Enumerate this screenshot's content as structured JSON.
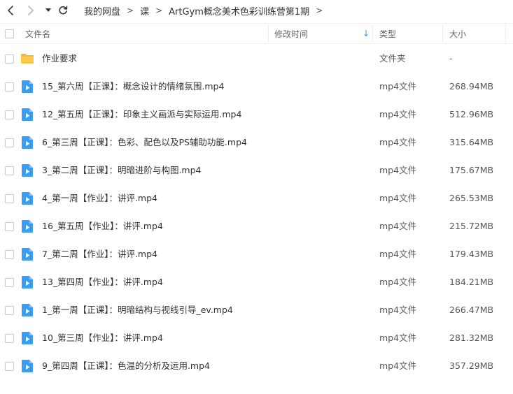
{
  "breadcrumb": {
    "items": [
      "我的网盘",
      "课",
      "ArtGym概念美术色彩训练营第1期"
    ],
    "separator": ">"
  },
  "columns": {
    "name": "文件名",
    "modified": "修改时间",
    "type": "类型",
    "size": "大小",
    "sort_indicator": "↓"
  },
  "colors": {
    "accent": "#1e9dea",
    "folder": "#f7b93e",
    "video": "#3a9df0"
  },
  "files": [
    {
      "name": "作业要求",
      "type": "文件夹",
      "size": "-",
      "icon": "folder-icon"
    },
    {
      "name": "15_第六周【正课】：概念设计的情绪氛围.mp4",
      "type": "mp4文件",
      "size": "268.94MB",
      "icon": "video-file-icon"
    },
    {
      "name": "12_第五周【正课】：印象主义画派与实际运用.mp4",
      "type": "mp4文件",
      "size": "512.96MB",
      "icon": "video-file-icon"
    },
    {
      "name": "6_第三周【正课】：色彩、配色以及PS辅助功能.mp4",
      "type": "mp4文件",
      "size": "315.64MB",
      "icon": "video-file-icon"
    },
    {
      "name": "3_第二周【正课】：明暗进阶与构图.mp4",
      "type": "mp4文件",
      "size": "175.67MB",
      "icon": "video-file-icon"
    },
    {
      "name": "4_第一周【作业】：讲评.mp4",
      "type": "mp4文件",
      "size": "265.53MB",
      "icon": "video-file-icon"
    },
    {
      "name": "16_第五周【作业】：讲评.mp4",
      "type": "mp4文件",
      "size": "215.72MB",
      "icon": "video-file-icon"
    },
    {
      "name": "7_第二周【作业】：讲评.mp4",
      "type": "mp4文件",
      "size": "179.43MB",
      "icon": "video-file-icon"
    },
    {
      "name": "13_第四周【作业】：讲评.mp4",
      "type": "mp4文件",
      "size": "184.21MB",
      "icon": "video-file-icon"
    },
    {
      "name": "1_第一周【正课】：明暗结构与视线引导_ev.mp4",
      "type": "mp4文件",
      "size": "266.47MB",
      "icon": "video-file-icon"
    },
    {
      "name": "10_第三周【作业】：讲评.mp4",
      "type": "mp4文件",
      "size": "281.32MB",
      "icon": "video-file-icon"
    },
    {
      "name": "9_第四周【正课】：色温的分析及运用.mp4",
      "type": "mp4文件",
      "size": "357.29MB",
      "icon": "video-file-icon"
    }
  ]
}
